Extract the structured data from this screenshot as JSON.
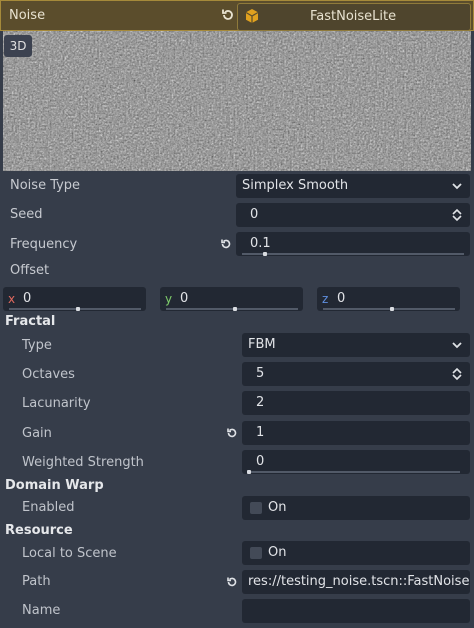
{
  "header": {
    "title": "Noise",
    "resource_type": "FastNoiseLite"
  },
  "preview": {
    "mode_label": "3D"
  },
  "properties": {
    "noise_type": {
      "label": "Noise Type",
      "value": "Simplex Smooth"
    },
    "seed": {
      "label": "Seed",
      "value": "0"
    },
    "frequency": {
      "label": "Frequency",
      "value": "0.1"
    },
    "offset": {
      "label": "Offset",
      "x_label": "x",
      "x": "0",
      "y_label": "y",
      "y": "0",
      "z_label": "z",
      "z": "0"
    }
  },
  "fractal": {
    "title": "Fractal",
    "type": {
      "label": "Type",
      "value": "FBM"
    },
    "octaves": {
      "label": "Octaves",
      "value": "5"
    },
    "lacunarity": {
      "label": "Lacunarity",
      "value": "2"
    },
    "gain": {
      "label": "Gain",
      "value": "1"
    },
    "weighted_strength": {
      "label": "Weighted Strength",
      "value": "0"
    }
  },
  "domain_warp": {
    "title": "Domain Warp",
    "enabled": {
      "label": "Enabled",
      "checkbox_label": "On"
    }
  },
  "resource": {
    "title": "Resource",
    "local_to_scene": {
      "label": "Local to Scene",
      "checkbox_label": "On"
    },
    "path": {
      "label": "Path",
      "value": "res://testing_noise.tscn::FastNoise"
    },
    "name": {
      "label": "Name",
      "value": ""
    }
  },
  "colors": {
    "header_bg": "#5b4d2c",
    "header_border": "#a68a3a",
    "panel_bg": "#363d4a",
    "field_bg": "#222833",
    "axis_x": "#e0695f",
    "axis_y": "#7fce6b",
    "axis_z": "#5f8fe0"
  }
}
